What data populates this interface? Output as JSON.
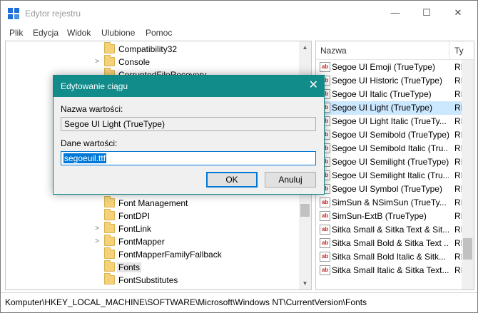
{
  "window": {
    "title": "Edytor rejestru",
    "minimize_glyph": "—",
    "maximize_glyph": "☐",
    "close_glyph": "✕"
  },
  "menu": [
    "Plik",
    "Edycja",
    "Widok",
    "Ulubione",
    "Pomoc"
  ],
  "tree": {
    "items": [
      {
        "label": "Compatibility32",
        "expandable": false
      },
      {
        "label": "Console",
        "expandable": true
      },
      {
        "label": "CorruptedFileRecovery",
        "expandable": false
      },
      {
        "label": "Font Management",
        "expandable": false
      },
      {
        "label": "FontDPI",
        "expandable": false
      },
      {
        "label": "FontLink",
        "expandable": true
      },
      {
        "label": "FontMapper",
        "expandable": true
      },
      {
        "label": "FontMapperFamilyFallback",
        "expandable": false
      },
      {
        "label": "Fonts",
        "expandable": false,
        "selected": true
      },
      {
        "label": "FontSubstitutes",
        "expandable": false
      }
    ]
  },
  "list": {
    "columns": {
      "name": "Nazwa",
      "type": "Ty"
    },
    "rows": [
      {
        "name": "Segoe UI Emoji (TrueType)",
        "type": "RI"
      },
      {
        "name": "Segoe UI Historic (TrueType)",
        "type": "RI"
      },
      {
        "name": "Segoe UI Italic (TrueType)",
        "type": "RI"
      },
      {
        "name": "Segoe UI Light (TrueType)",
        "type": "RI",
        "selected": true
      },
      {
        "name": "Segoe UI Light Italic (TrueTy...",
        "type": "RI"
      },
      {
        "name": "Segoe UI Semibold (TrueType)",
        "type": "RI"
      },
      {
        "name": "Segoe UI Semibold Italic (Tru...",
        "type": "RI"
      },
      {
        "name": "Segoe UI Semilight (TrueType)",
        "type": "RI"
      },
      {
        "name": "Segoe UI Semilight Italic (Tru...",
        "type": "RI"
      },
      {
        "name": "Segoe UI Symbol (TrueType)",
        "type": "RI"
      },
      {
        "name": "SimSun & NSimSun (TrueTy...",
        "type": "RI"
      },
      {
        "name": "SimSun-ExtB (TrueType)",
        "type": "RI"
      },
      {
        "name": "Sitka Small & Sitka Text & Sit...",
        "type": "RI"
      },
      {
        "name": "Sitka Small Bold & Sitka Text ...",
        "type": "RI"
      },
      {
        "name": "Sitka Small Bold Italic & Sitk...",
        "type": "RI"
      },
      {
        "name": "Sitka Small Italic & Sitka Text...",
        "type": "RI"
      }
    ],
    "icon_text": "ab"
  },
  "status": {
    "path": "Komputer\\HKEY_LOCAL_MACHINE\\SOFTWARE\\Microsoft\\Windows NT\\CurrentVersion\\Fonts"
  },
  "dialog": {
    "title": "Edytowanie ciągu",
    "close_glyph": "✕",
    "name_label": "Nazwa wartości:",
    "name_value": "Segoe UI Light (TrueType)",
    "data_label": "Dane wartości:",
    "data_value": "segoeuil.ttf",
    "ok_label": "OK",
    "cancel_label": "Anuluj"
  },
  "colors": {
    "dialog_title_bg": "#128b8b",
    "selection": "#0078d7",
    "list_selected_bg": "#cce8ff"
  }
}
